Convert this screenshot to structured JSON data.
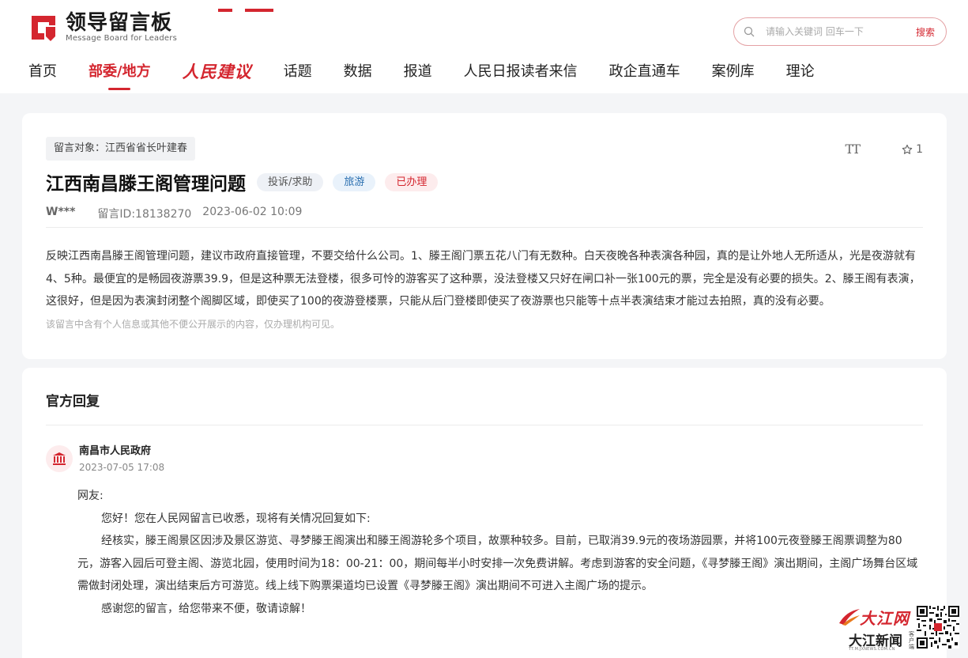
{
  "header": {
    "logo_title": "领导留言板",
    "logo_subtitle": "Message Board for Leaders",
    "search": {
      "placeholder": "请输入关键词 回车一下",
      "button_label": "搜索"
    },
    "nav": [
      {
        "label": "首页"
      },
      {
        "label": "部委/地方",
        "active": true
      },
      {
        "label": "人民建议"
      },
      {
        "label": "话题"
      },
      {
        "label": "数据"
      },
      {
        "label": "报道"
      },
      {
        "label": "人民日报读者来信"
      },
      {
        "label": "政企直通车"
      },
      {
        "label": "案例库"
      },
      {
        "label": "理论"
      }
    ]
  },
  "message": {
    "target": "留言对象：江西省省长叶建春",
    "title": "江西南昌滕王阁管理问题",
    "tags": {
      "type": "投诉/求助",
      "domain": "旅游",
      "status": "已办理"
    },
    "font_size_icon_label": "TT",
    "favorite_count": "1",
    "author": "W***",
    "message_id": "留言ID:18138270",
    "time": "2023-06-02 10:09",
    "content": "反映江西南昌滕王阁管理问题，建议市政府直接管理，不要交给什么公司。1、滕王阁门票五花八门有无数种。白天夜晚各种表演各种园，真的是让外地人无所适从，光是夜游就有4、5种。最便宜的是畅园夜游票39.9，但是这种票无法登楼，很多可怜的游客买了这种票，没法登楼又只好在闸口补一张100元的票，完全是没有必要的损失。2、滕王阁有表演，这很好，但是因为表演封闭整个阁脚区域，即使买了100的夜游登楼票，只能从后门登楼即使买了夜游票也只能等十点半表演结束才能过去拍照，真的没有必要。",
    "privacy_notice": "该留言中含有个人信息或其他不便公开展示的内容，仅办理机构可见。"
  },
  "reply": {
    "heading": "官方回复",
    "org_name": "南昌市人民政府",
    "org_time": "2023-07-05 17:08",
    "salutation": "网友:",
    "paragraphs": [
      "您好！您在人民网留言已收悉，现将有关情况回复如下:",
      "经核实，滕王阁景区因涉及景区游览、寻梦滕王阁演出和滕王阁游轮多个项目，故票种较多。目前，已取消39.9元的夜场游园票，并将100元夜登滕王阁票调整为80元，游客入园后可登主阁、游览北园，使用时间为18：00-21：00，期间每半小时安排一次免费讲解。考虑到游客的安全问题，《寻梦滕王阁》演出期间，主阁广场舞台区域需做封闭处理，演出结束后方可游览。线上线下购票渠道均已设置《寻梦滕王阁》演出期间不可进入主阁广场的提示。",
      "感谢您的留言，给您带来不便，敬请谅解！"
    ]
  },
  "watermark": {
    "brand_top": "大江网",
    "brand_bottom": "大江新闻",
    "url": "TT.M.JXNEWS.COM.CN",
    "side": "客户端"
  },
  "colors": {
    "accent": "#d4262f",
    "blue_tag": "#2a6fb0"
  }
}
